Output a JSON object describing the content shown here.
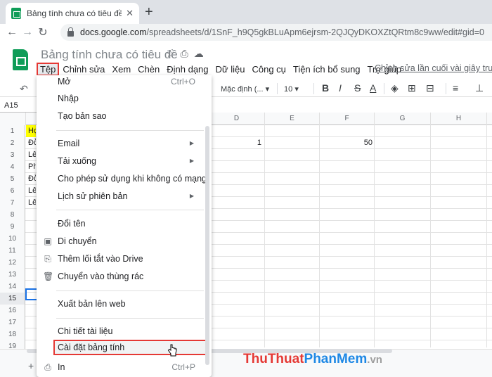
{
  "browser": {
    "tab_title": "Bảng tính chưa có tiêu đề - Goog",
    "close_glyph": "✕",
    "new_tab_glyph": "+",
    "url_host": "docs.google.com",
    "url_path": "/spreadsheets/d/1SnF_h9Q5gkBLuApm6ejrsm-2QJQyDKOXZtQRtm8c9ww/edit#gid=0",
    "back_glyph": "←",
    "forward_glyph": "→",
    "reload_glyph": "↻"
  },
  "sheets": {
    "doc_title": "Bảng tính chưa có tiêu đề",
    "title_icons": "☆⎙☁",
    "menu": [
      "Tệp",
      "Chỉnh sửa",
      "Xem",
      "Chèn",
      "Định dạng",
      "Dữ liệu",
      "Công cụ",
      "Tiện ích bổ sung",
      "Trợ giúp"
    ],
    "last_edit": "Chỉnh sửa lần cuối vài giây trước"
  },
  "toolbar": {
    "undo_glyph": "↶",
    "font": "Mặc định (...",
    "font_caret": "▾",
    "size": "10",
    "bold": "B",
    "italic": "I",
    "strike": "S",
    "text_color": "A",
    "fill": "◈",
    "borders": "⊞",
    "merge": "⊟",
    "align": "≡",
    "valign": "⊥"
  },
  "namebox": "A15",
  "grid": {
    "columns": [
      "D",
      "E",
      "F",
      "G",
      "H"
    ],
    "rows": [
      "1",
      "2",
      "3",
      "4",
      "5",
      "6",
      "7",
      "8",
      "9",
      "10",
      "11",
      "12",
      "13",
      "14",
      "15",
      "16",
      "17",
      "18",
      "19"
    ],
    "peek_a": {
      "1": "Họ",
      "2": "Đỗ",
      "3": "Lê",
      "4": "Ph",
      "5": "Đỗ",
      "6": "Lê",
      "7": "Lê"
    },
    "d2": "1",
    "f2": "50",
    "add_sheet": "+"
  },
  "file_menu": {
    "items": [
      {
        "label": "Mở",
        "shortcut": "Ctrl+O"
      },
      {
        "label": "Nhập"
      },
      {
        "label": "Tạo bản sao"
      },
      {
        "label": "Email",
        "arrow": "▶"
      },
      {
        "label": "Tải xuống",
        "arrow": "▶"
      },
      {
        "label": "Cho phép sử dụng khi không có mạng"
      },
      {
        "label": "Lịch sử phiên bản",
        "arrow": "▶"
      },
      {
        "label": "Đổi tên"
      },
      {
        "label": "Di chuyển",
        "icon": "▣"
      },
      {
        "label": "Thêm lối tắt vào Drive",
        "icon": "⎘"
      },
      {
        "label": "Chuyển vào thùng rác",
        "icon": "🗑"
      },
      {
        "label": "Xuất bản lên web"
      },
      {
        "label": "Chi tiết tài liệu"
      },
      {
        "label": "Cài đặt bảng tính"
      },
      {
        "label": "In",
        "shortcut": "Ctrl+P",
        "icon": "⎙"
      }
    ]
  },
  "watermark": {
    "a": "ThuThuat",
    "b": "PhanMem",
    "c": ".vn"
  },
  "colors": {
    "highlight_border": "#e53935",
    "sheets_green": "#0f9d58",
    "selection": "#1a73e8"
  }
}
